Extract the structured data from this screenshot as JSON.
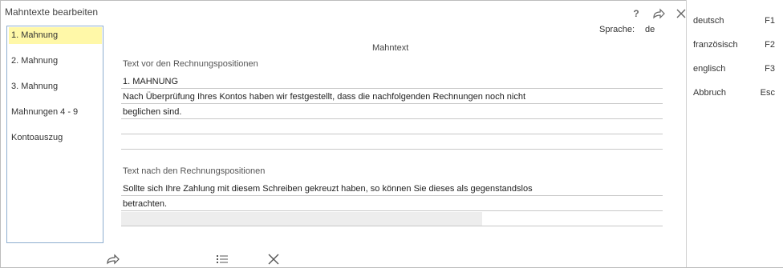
{
  "window": {
    "title": "Mahntexte bearbeiten"
  },
  "header": {
    "language_label": "Sprache:",
    "language_value": "de"
  },
  "left_list": {
    "items": [
      {
        "label": "1. Mahnung",
        "selected": true
      },
      {
        "label": "2. Mahnung",
        "selected": false
      },
      {
        "label": "3. Mahnung",
        "selected": false
      },
      {
        "label": "Mahnungen 4 - 9",
        "selected": false
      },
      {
        "label": "Kontoauszug",
        "selected": false
      }
    ]
  },
  "editor": {
    "heading": "Mahntext",
    "before_label": "Text vor den Rechnungspositionen",
    "before_lines": [
      "1. MAHNUNG",
      "Nach Überprüfung Ihres Kontos haben wir festgestellt, dass die nachfolgenden Rechnungen noch nicht",
      "beglichen sind.",
      "",
      ""
    ],
    "after_label": "Text nach den Rechnungspositionen",
    "after_lines": [
      "Sollte sich Ihre Zahlung mit diesem Schreiben gekreuzt haben, so können Sie dieses als gegenstandslos",
      "betrachten.",
      ""
    ]
  },
  "right_panel": {
    "items": [
      {
        "label": "deutsch",
        "key": "F1"
      },
      {
        "label": "französisch",
        "key": "F2"
      },
      {
        "label": "englisch",
        "key": "F3"
      },
      {
        "label": "Abbruch",
        "key": "Esc"
      }
    ]
  },
  "icons": {
    "help": "?",
    "forward": "forward-icon",
    "close": "close-icon",
    "list": "list-icon"
  }
}
